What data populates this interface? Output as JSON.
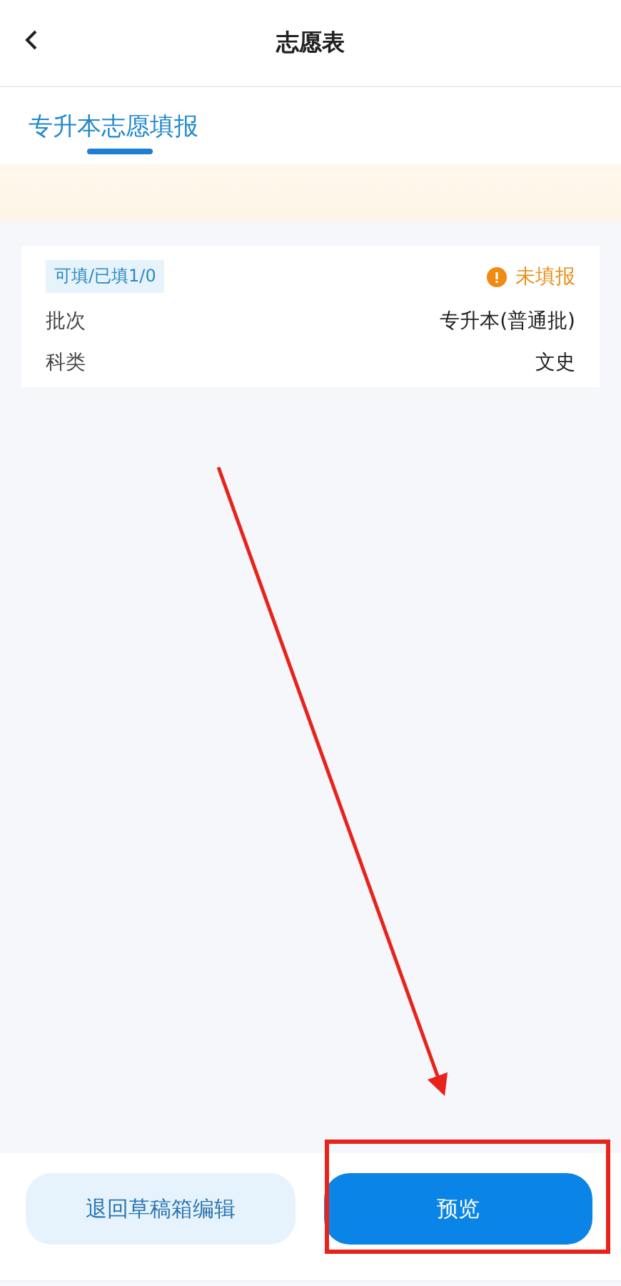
{
  "header": {
    "title": "志愿表"
  },
  "tabs": [
    {
      "label": "专升本志愿填报",
      "selected": true
    }
  ],
  "card": {
    "quota": "可填/已填1/0",
    "status": "未填报",
    "rows": [
      {
        "label": "批次",
        "value": "专升本(普通批)"
      },
      {
        "label": "科类",
        "value": "文史"
      }
    ]
  },
  "buttons": [
    {
      "label": "退回草稿箱编辑",
      "kind": "secondary"
    },
    {
      "label": "预览",
      "kind": "primary"
    }
  ]
}
